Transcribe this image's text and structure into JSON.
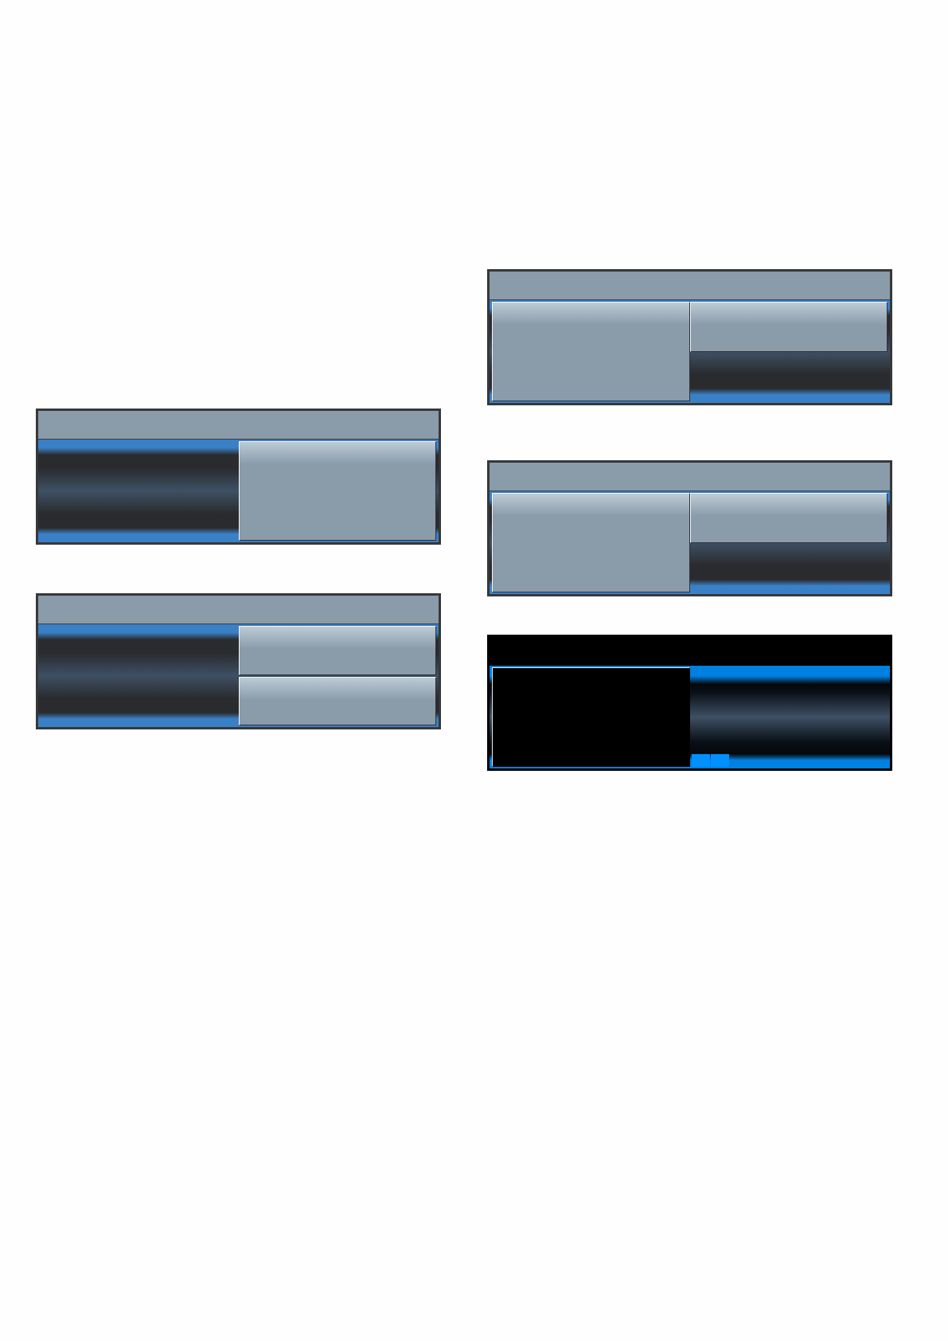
{
  "left_column": {
    "panels": [
      {
        "kind": "light",
        "panes": [
          {
            "cells": [
              {
                "kind": "empty"
              }
            ]
          },
          {
            "cells": [
              {
                "kind": "tile"
              }
            ]
          }
        ]
      },
      {
        "kind": "light",
        "panes": [
          {
            "cells": [
              {
                "kind": "empty"
              }
            ]
          },
          {
            "cells": [
              {
                "kind": "tile"
              },
              {
                "kind": "tile"
              }
            ]
          }
        ]
      }
    ]
  },
  "right_column": {
    "panels": [
      {
        "kind": "light",
        "panes": [
          {
            "cells": [
              {
                "kind": "tile"
              }
            ]
          },
          {
            "cells": [
              {
                "kind": "tile"
              },
              {
                "kind": "empty"
              }
            ]
          }
        ]
      },
      {
        "kind": "light",
        "panes": [
          {
            "cells": [
              {
                "kind": "tile"
              }
            ]
          },
          {
            "cells": [
              {
                "kind": "tile"
              },
              {
                "kind": "empty"
              }
            ]
          }
        ]
      },
      {
        "kind": "dark",
        "panes": [
          {
            "cells": [
              {
                "kind": "tile"
              }
            ]
          },
          {
            "cells": [
              {
                "kind": "empty",
                "indicators": [
                  {
                    "kind": "square"
                  },
                  {
                    "kind": "square"
                  }
                ]
              }
            ]
          }
        ]
      }
    ]
  }
}
